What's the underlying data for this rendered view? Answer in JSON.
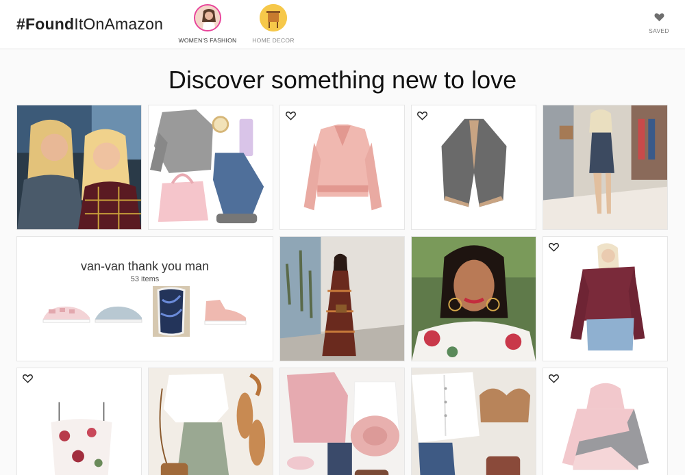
{
  "header": {
    "logo_bold": "#Found",
    "logo_rest": "ItOnAmazon",
    "categories": [
      {
        "label": "WOMEN'S FASHION",
        "selected": true
      },
      {
        "label": "HOME DECOR",
        "selected": false
      }
    ],
    "saved_label": "SAVED",
    "accent_color": "#e8449a"
  },
  "main": {
    "title": "Discover something new to love",
    "collection": {
      "title": "van-van thank you man",
      "count": "53 items"
    },
    "tiles": [
      {
        "name": "friends-photo",
        "heart": false
      },
      {
        "name": "sweater-outfit-flatlay",
        "heart": false
      },
      {
        "name": "pink-suede-jacket",
        "heart": true
      },
      {
        "name": "gray-poncho-wrap",
        "heart": true
      },
      {
        "name": "mirror-selfie-romper",
        "heart": false
      },
      {
        "name": "maxi-dress-photo",
        "heart": false
      },
      {
        "name": "floral-top-selfie",
        "heart": false
      },
      {
        "name": "burgundy-knit-sweater",
        "heart": true
      },
      {
        "name": "floral-cami-top",
        "heart": true
      },
      {
        "name": "summer-outfit-flatlay",
        "heart": false
      },
      {
        "name": "pink-outfit-flatlay",
        "heart": false
      },
      {
        "name": "bralette-outfit-flatlay",
        "heart": false
      },
      {
        "name": "colorblock-hoodie",
        "heart": true
      }
    ]
  }
}
